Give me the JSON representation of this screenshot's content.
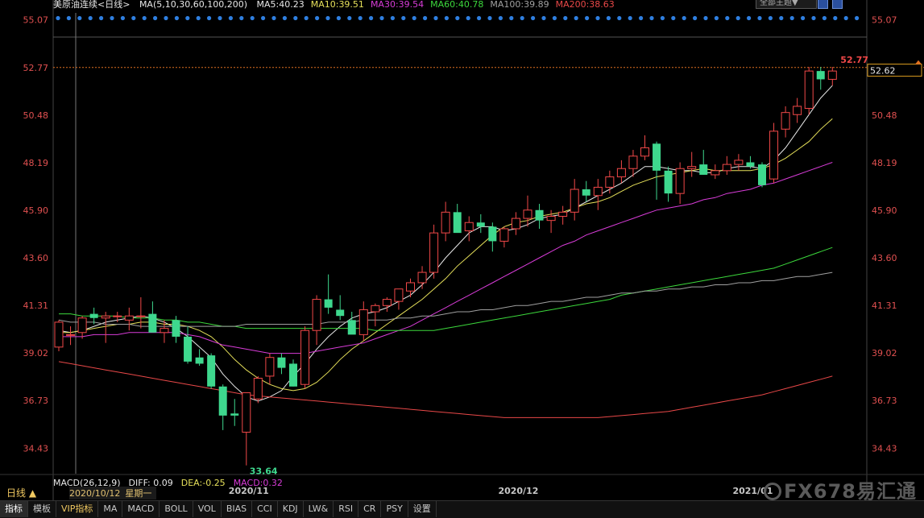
{
  "header": {
    "instrument": "美原油连续<日线>",
    "ma_summary": "MA(5,10,30,60,100,200)",
    "ma_values": [
      {
        "label": "MA5:40.23",
        "color": "#e8e8e8"
      },
      {
        "label": "MA10:39.51",
        "color": "#e6e05a"
      },
      {
        "label": "MA30:39.54",
        "color": "#d83cd8"
      },
      {
        "label": "MA60:40.78",
        "color": "#3cd83c"
      },
      {
        "label": "MA100:39.89",
        "color": "#a0a0a0"
      },
      {
        "label": "MA200:38.63",
        "color": "#e84848"
      }
    ],
    "theme_button": "全部主题▼"
  },
  "indicator": {
    "macd_params": "MACD(26,12,9)",
    "diff": "DIFF: 0.09",
    "dea": "DEA:-0.25",
    "macd": "MACD:0.32",
    "period_label": "日线 ▲",
    "cursor_date": "2020/10/12",
    "cursor_weekday": "星期一"
  },
  "toolbar": {
    "tabs": [
      "指标",
      "模板",
      "VIP指标",
      "MA",
      "MACD",
      "BOLL",
      "VOL",
      "BIAS",
      "CCI",
      "KDJ",
      "LW&",
      "RSI",
      "CR",
      "PSY",
      "设置"
    ]
  },
  "watermark": "FX678易汇通",
  "chart_data": {
    "type": "candlestick",
    "title": "美原油连续<日线>",
    "ylim": [
      33.2,
      55.4
    ],
    "y_ticks": [
      "55.07",
      "52.77",
      "50.48",
      "48.19",
      "45.90",
      "43.60",
      "41.31",
      "39.02",
      "36.73",
      "34.43"
    ],
    "x_tick_labels": [
      "2020/11",
      "2020/12",
      "2021/01"
    ],
    "x_tick_index": [
      16,
      39,
      59
    ],
    "last_price": "52.62",
    "high_marker": "52.77",
    "low_marker": "33.64",
    "colors": {
      "up": "#f04848",
      "down": "#3ed88e",
      "grid_label": "#e05050"
    },
    "candles": [
      [
        39.3,
        40.6,
        39.1,
        40.5
      ],
      [
        39.9,
        40.3,
        39.4,
        39.9
      ],
      [
        40.0,
        40.8,
        39.7,
        40.7
      ],
      [
        40.9,
        41.2,
        40.4,
        40.7
      ],
      [
        40.7,
        41.0,
        39.5,
        40.8
      ],
      [
        40.8,
        41.0,
        40.5,
        40.8
      ],
      [
        40.6,
        41.2,
        40.1,
        40.8
      ],
      [
        40.8,
        41.7,
        40.2,
        40.8
      ],
      [
        40.9,
        41.5,
        40.0,
        40.0
      ],
      [
        40.0,
        40.6,
        39.5,
        40.2
      ],
      [
        40.6,
        40.8,
        39.5,
        39.8
      ],
      [
        39.8,
        40.3,
        38.5,
        38.6
      ],
      [
        38.8,
        39.2,
        38.4,
        38.5
      ],
      [
        38.9,
        39.0,
        37.3,
        37.4
      ],
      [
        37.4,
        37.5,
        35.3,
        36.0
      ],
      [
        36.1,
        36.8,
        35.5,
        36.0
      ],
      [
        35.2,
        37.0,
        33.6,
        37.1
      ],
      [
        36.8,
        37.9,
        36.6,
        37.8
      ],
      [
        37.9,
        39.0,
        37.5,
        38.8
      ],
      [
        38.8,
        39.0,
        38.0,
        38.3
      ],
      [
        38.5,
        38.7,
        37.4,
        37.4
      ],
      [
        37.5,
        40.3,
        37.3,
        40.1
      ],
      [
        40.1,
        41.8,
        39.4,
        41.6
      ],
      [
        41.6,
        42.8,
        40.9,
        41.2
      ],
      [
        41.1,
        41.8,
        40.6,
        40.8
      ],
      [
        40.6,
        41.0,
        40.1,
        39.9
      ],
      [
        39.9,
        41.5,
        39.6,
        41.1
      ],
      [
        41.0,
        41.4,
        40.3,
        41.3
      ],
      [
        41.3,
        41.7,
        41.0,
        41.6
      ],
      [
        41.5,
        41.9,
        41.1,
        42.1
      ],
      [
        42.0,
        42.6,
        41.7,
        42.4
      ],
      [
        42.4,
        43.2,
        42.1,
        42.9
      ],
      [
        42.9,
        45.2,
        42.6,
        44.8
      ],
      [
        44.8,
        46.3,
        44.4,
        45.8
      ],
      [
        45.8,
        46.2,
        44.9,
        44.8
      ],
      [
        44.9,
        45.6,
        44.4,
        45.3
      ],
      [
        45.3,
        45.7,
        44.8,
        45.1
      ],
      [
        45.1,
        45.3,
        43.9,
        44.4
      ],
      [
        44.4,
        45.1,
        44.1,
        45.0
      ],
      [
        45.0,
        45.8,
        44.7,
        45.5
      ],
      [
        45.5,
        46.6,
        45.1,
        45.9
      ],
      [
        45.9,
        46.2,
        45.0,
        45.4
      ],
      [
        45.4,
        45.9,
        44.8,
        45.6
      ],
      [
        45.6,
        46.1,
        45.2,
        45.8
      ],
      [
        45.8,
        47.4,
        45.4,
        46.9
      ],
      [
        46.9,
        47.3,
        46.3,
        46.6
      ],
      [
        46.6,
        47.4,
        45.9,
        47.0
      ],
      [
        47.0,
        47.8,
        46.7,
        47.5
      ],
      [
        47.5,
        48.3,
        47.2,
        47.9
      ],
      [
        47.9,
        48.8,
        47.5,
        48.5
      ],
      [
        48.5,
        49.5,
        48.3,
        48.9
      ],
      [
        49.1,
        49.2,
        46.4,
        47.8
      ],
      [
        47.8,
        48.0,
        46.3,
        46.7
      ],
      [
        46.7,
        48.2,
        46.2,
        47.9
      ],
      [
        47.9,
        48.7,
        47.5,
        48.0
      ],
      [
        48.1,
        48.8,
        47.6,
        47.6
      ],
      [
        47.6,
        48.1,
        47.4,
        47.8
      ],
      [
        47.8,
        48.5,
        47.6,
        48.1
      ],
      [
        48.1,
        48.6,
        47.8,
        48.3
      ],
      [
        48.2,
        48.5,
        47.9,
        48.0
      ],
      [
        48.1,
        48.2,
        47.0,
        47.1
      ],
      [
        47.4,
        50.1,
        47.2,
        49.7
      ],
      [
        49.8,
        50.9,
        49.4,
        50.6
      ],
      [
        50.5,
        51.3,
        50.1,
        50.9
      ],
      [
        50.8,
        52.8,
        50.5,
        52.6
      ],
      [
        52.6,
        52.8,
        51.7,
        52.2
      ],
      [
        52.2,
        52.8,
        51.9,
        52.6
      ]
    ],
    "moving_averages": [
      {
        "name": "MA5",
        "color": "#e8e8e8",
        "values": [
          40.1,
          40.0,
          40.1,
          40.3,
          40.5,
          40.6,
          40.7,
          40.8,
          40.7,
          40.5,
          40.2,
          39.8,
          39.3,
          38.8,
          38.0,
          37.4,
          36.9,
          36.7,
          36.9,
          37.2,
          37.9,
          38.5,
          39.2,
          39.8,
          40.3,
          40.7,
          40.9,
          41.0,
          41.2,
          41.5,
          41.8,
          42.3,
          42.9,
          43.6,
          44.2,
          44.8,
          45.1,
          45.1,
          44.9,
          45.0,
          45.2,
          45.5,
          45.6,
          45.7,
          46.0,
          46.3,
          46.6,
          46.9,
          47.2,
          47.6,
          48.0,
          48.0,
          47.9,
          47.8,
          47.8,
          47.7,
          47.7,
          47.9,
          48.0,
          48.0,
          47.9,
          48.3,
          48.9,
          49.7,
          50.5,
          51.3,
          51.9
        ]
      },
      {
        "name": "MA10",
        "color": "#e6e05a",
        "values": [
          40.0,
          40.0,
          40.1,
          40.2,
          40.3,
          40.4,
          40.4,
          40.5,
          40.5,
          40.4,
          40.4,
          40.3,
          40.1,
          39.8,
          39.3,
          38.7,
          38.2,
          37.8,
          37.5,
          37.3,
          37.2,
          37.3,
          37.6,
          38.1,
          38.7,
          39.2,
          39.6,
          40.0,
          40.4,
          40.8,
          41.2,
          41.6,
          42.1,
          42.6,
          43.2,
          43.7,
          44.2,
          44.7,
          45.1,
          45.3,
          45.4,
          45.6,
          45.7,
          45.8,
          46.0,
          46.2,
          46.3,
          46.5,
          46.8,
          47.1,
          47.3,
          47.5,
          47.6,
          47.7,
          47.8,
          47.9,
          47.8,
          47.8,
          47.8,
          47.8,
          47.9,
          48.1,
          48.4,
          48.8,
          49.2,
          49.8,
          50.3
        ]
      },
      {
        "name": "MA30",
        "color": "#d83cd8",
        "values": [
          39.8,
          39.8,
          39.8,
          39.9,
          39.9,
          39.9,
          40.0,
          40.0,
          40.0,
          40.0,
          40.0,
          39.9,
          39.8,
          39.6,
          39.4,
          39.3,
          39.2,
          39.1,
          39.0,
          39.0,
          39.0,
          39.0,
          39.1,
          39.2,
          39.3,
          39.4,
          39.5,
          39.7,
          39.9,
          40.1,
          40.3,
          40.6,
          40.9,
          41.2,
          41.5,
          41.8,
          42.1,
          42.4,
          42.7,
          43.0,
          43.3,
          43.6,
          43.9,
          44.2,
          44.4,
          44.7,
          44.9,
          45.1,
          45.3,
          45.5,
          45.7,
          45.9,
          46.0,
          46.1,
          46.2,
          46.4,
          46.5,
          46.7,
          46.8,
          46.9,
          47.1,
          47.2,
          47.4,
          47.6,
          47.8,
          48.0,
          48.2
        ]
      },
      {
        "name": "MA60",
        "color": "#3cd83c",
        "values": [
          40.9,
          40.9,
          40.8,
          40.8,
          40.8,
          40.8,
          40.7,
          40.7,
          40.7,
          40.6,
          40.6,
          40.5,
          40.5,
          40.4,
          40.3,
          40.3,
          40.2,
          40.2,
          40.2,
          40.2,
          40.2,
          40.2,
          40.2,
          40.2,
          40.2,
          40.2,
          40.2,
          40.1,
          40.1,
          40.1,
          40.1,
          40.1,
          40.1,
          40.2,
          40.3,
          40.4,
          40.5,
          40.6,
          40.7,
          40.8,
          40.9,
          41.0,
          41.1,
          41.2,
          41.3,
          41.4,
          41.5,
          41.6,
          41.8,
          41.9,
          42.0,
          42.1,
          42.2,
          42.3,
          42.4,
          42.5,
          42.6,
          42.7,
          42.8,
          42.9,
          43.0,
          43.1,
          43.3,
          43.5,
          43.7,
          43.9,
          44.1
        ]
      },
      {
        "name": "MA100",
        "color": "#a0a0a0",
        "values": [
          40.6,
          40.5,
          40.5,
          40.5,
          40.4,
          40.4,
          40.4,
          40.3,
          40.3,
          40.3,
          40.3,
          40.3,
          40.3,
          40.3,
          40.3,
          40.3,
          40.4,
          40.4,
          40.4,
          40.4,
          40.4,
          40.4,
          40.4,
          40.5,
          40.5,
          40.5,
          40.6,
          40.6,
          40.6,
          40.7,
          40.7,
          40.8,
          40.8,
          40.9,
          41.0,
          41.0,
          41.1,
          41.1,
          41.2,
          41.3,
          41.3,
          41.4,
          41.5,
          41.5,
          41.6,
          41.7,
          41.7,
          41.8,
          41.9,
          41.9,
          42.0,
          42.0,
          42.1,
          42.1,
          42.2,
          42.2,
          42.3,
          42.3,
          42.4,
          42.4,
          42.5,
          42.5,
          42.6,
          42.7,
          42.7,
          42.8,
          42.9
        ]
      },
      {
        "name": "MA200",
        "color": "#e84848",
        "values": [
          38.6,
          38.5,
          38.4,
          38.3,
          38.2,
          38.1,
          38.0,
          37.9,
          37.8,
          37.7,
          37.6,
          37.5,
          37.4,
          37.3,
          37.2,
          37.1,
          37.0,
          36.95,
          36.9,
          36.85,
          36.8,
          36.75,
          36.7,
          36.65,
          36.6,
          36.55,
          36.5,
          36.45,
          36.4,
          36.35,
          36.3,
          36.25,
          36.2,
          36.15,
          36.1,
          36.05,
          36.0,
          35.95,
          35.9,
          35.9,
          35.9,
          35.9,
          35.9,
          35.9,
          35.9,
          35.9,
          35.9,
          35.95,
          36.0,
          36.05,
          36.1,
          36.15,
          36.2,
          36.3,
          36.4,
          36.5,
          36.6,
          36.7,
          36.8,
          36.9,
          37.0,
          37.15,
          37.3,
          37.45,
          37.6,
          37.75,
          37.9
        ]
      }
    ]
  }
}
